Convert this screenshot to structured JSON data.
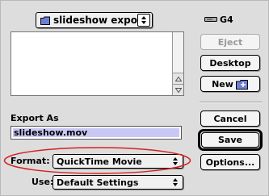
{
  "location_popup": {
    "label": "slideshow export"
  },
  "disk": {
    "label": "G4"
  },
  "buttons": {
    "eject": "Eject",
    "desktop": "Desktop",
    "new_folder": "New",
    "cancel": "Cancel",
    "save": "Save",
    "options": "Options..."
  },
  "export": {
    "label": "Export As",
    "filename": "slideshow.mov"
  },
  "format": {
    "label": "Format:",
    "value": "QuickTime Movie"
  },
  "use": {
    "label": "Use:",
    "value": "Default Settings"
  },
  "colors": {
    "annotation_ellipse": "#d62020",
    "filename_selection": "#c9c8f5"
  }
}
